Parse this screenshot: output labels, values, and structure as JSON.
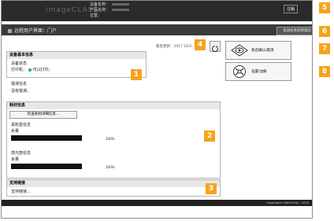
{
  "header": {
    "logo": "imageCLASS",
    "device_name_label": "设备名称：",
    "product_name_label": "产品名称：",
    "location_label": "位置：",
    "logout_label": "注销"
  },
  "titlebar": {
    "title": "远程用户界面：门户",
    "mail_button_label": "发送给系统管理员"
  },
  "status": {
    "last_updated": "最后更新：2017 10/1..."
  },
  "device_box": {
    "title": "设备基本信息",
    "device_label": "设备状态",
    "printer_label": "打印机：",
    "printer_status": "可以打印。",
    "error_label": "错误信息",
    "error_value": "没有错误。"
  },
  "consumables_box": {
    "title": "耗材信息",
    "check_button": "检查耗材详细信息...",
    "black_cartridge": "黑粉盒信息",
    "black_sub": "余量",
    "black_pct": "100%",
    "drum_label": "感光鼓信息",
    "drum_sub": "余量",
    "drum_pct": "100%"
  },
  "support_box": {
    "title": "支持链接",
    "link": "支持链接..."
  },
  "side_buttons": [
    {
      "label": "状态确认/取消"
    },
    {
      "label": "设置/注册"
    }
  ],
  "footer": {
    "copyright": "Copyright CANON INC. 2016"
  },
  "badges": [
    "1",
    "2",
    "3",
    "4",
    "5",
    "6",
    "7",
    "8"
  ],
  "colors": {
    "badge": "#f7a21b",
    "header": "#2a2a2a",
    "ok_dot": "#2db34a"
  }
}
